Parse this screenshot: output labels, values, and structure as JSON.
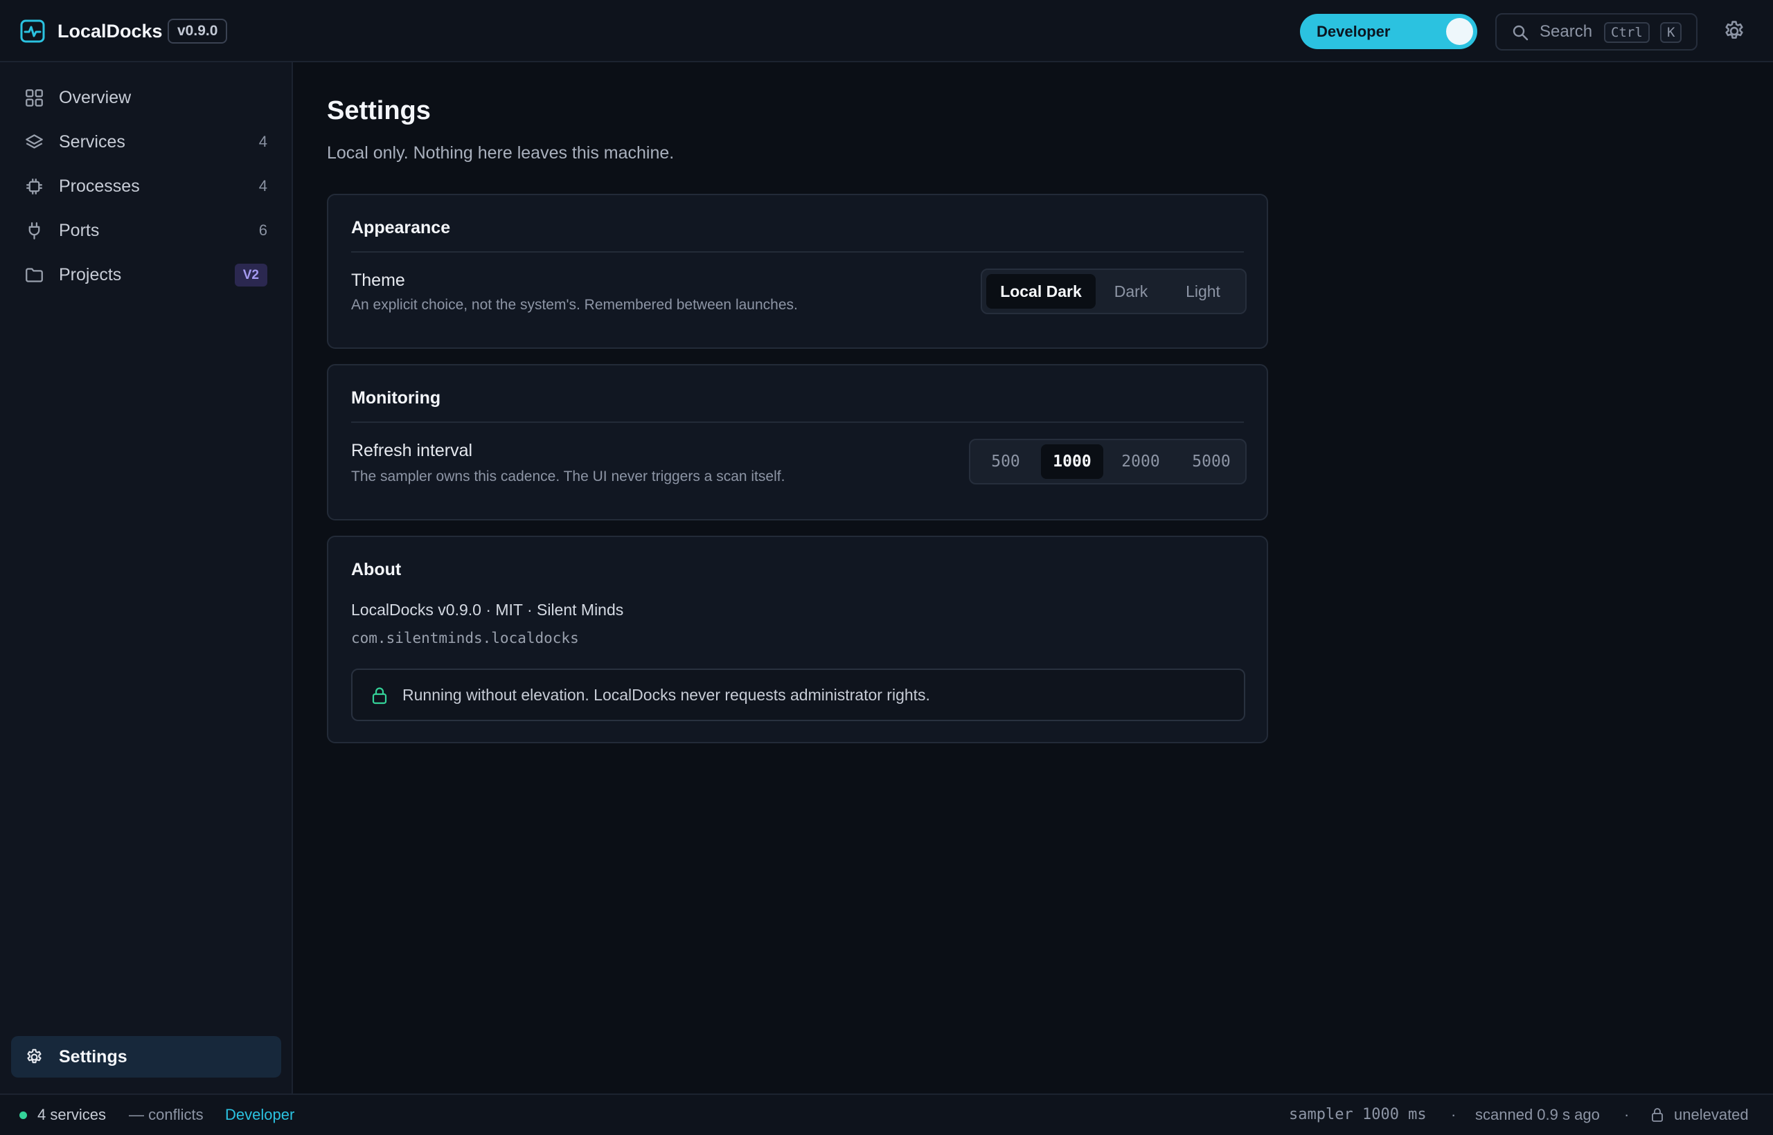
{
  "app": {
    "title": "LocalDocks",
    "version": "v0.9.0",
    "logo_icon": "activity-monitor-icon"
  },
  "header": {
    "mode_toggle": {
      "label": "Developer",
      "on": true
    },
    "search": {
      "label": "Search",
      "shortcut_keys": [
        "Ctrl",
        "K"
      ]
    },
    "settings_icon": "gear-icon"
  },
  "sidebar": {
    "items": [
      {
        "label": "Overview",
        "icon": "grid-icon",
        "count": ""
      },
      {
        "label": "Services",
        "icon": "layers-icon",
        "count": "4"
      },
      {
        "label": "Processes",
        "icon": "cpu-chip-icon",
        "count": "4"
      },
      {
        "label": "Ports",
        "icon": "plug-icon",
        "count": "6"
      },
      {
        "label": "Projects",
        "icon": "folder-icon",
        "badge": "V2"
      }
    ],
    "footer_item": {
      "label": "Settings",
      "icon": "gear-icon",
      "active": true
    }
  },
  "main": {
    "title": "Settings",
    "subtitle": "Local only. Nothing here leaves this machine.",
    "appearance": {
      "title": "Appearance",
      "theme_label": "Theme",
      "theme_desc": "An explicit choice, not the system's. Remembered between launches.",
      "options": [
        "Local Dark",
        "Dark",
        "Light"
      ],
      "selected": "Local Dark"
    },
    "monitoring": {
      "title": "Monitoring",
      "interval_label": "Refresh interval",
      "interval_desc": "The sampler owns this cadence. The UI never triggers a scan itself.",
      "options": [
        "500",
        "1000",
        "2000",
        "5000"
      ],
      "selected": "1000"
    },
    "about": {
      "title": "About",
      "line": "LocalDocks v0.9.0 · MIT · Silent Minds",
      "bundle_id": "com.silentminds.localdocks",
      "notice": "Running without elevation. LocalDocks never requests administrator rights."
    }
  },
  "statusbar": {
    "services": "4 services",
    "conflicts": "— conflicts",
    "mode": "Developer",
    "sampler": "sampler 1000 ms",
    "separator": "·",
    "scanned": "scanned 0.9 s ago",
    "elevation": "unelevated"
  },
  "colors": {
    "accent": "#2bc2e0",
    "success": "#34d399",
    "badge_purple": "#a59af0",
    "background": "#0b0f16"
  }
}
